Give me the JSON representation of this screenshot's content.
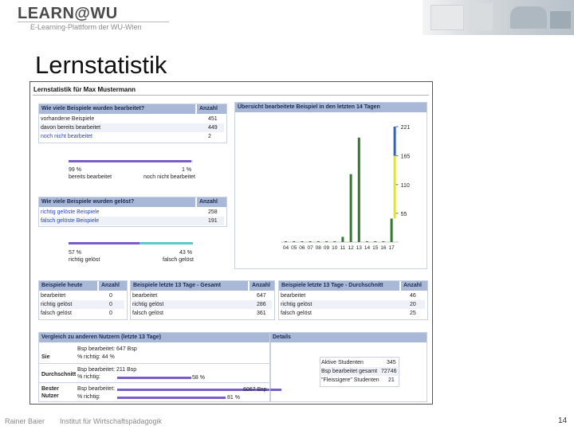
{
  "header": {
    "logo": "LEARN@WU",
    "subtitle": "E-Learning-Plattform der WU-Wien"
  },
  "page_title": "Lernstatistik",
  "stats_title": "Lernstatistik für Max Mustermann",
  "processed": {
    "header": "Wie viele Beispiele wurden bearbeitet?",
    "count_header": "Anzahl",
    "rows": [
      {
        "label": "vorhandene Beispiele",
        "value": "451"
      },
      {
        "label": "davon bereits bearbeitet",
        "value": "449"
      },
      {
        "label": "noch nicht bearbeitet",
        "value": "2"
      }
    ],
    "bar": {
      "done_fraction": 0.99,
      "left_pct": "99 %",
      "left_label": "bereits bearbeitet",
      "right_pct": "1 %",
      "right_label": "noch nicht bearbeitet"
    }
  },
  "solved": {
    "header": "Wie viele Beispiele wurden gelöst?",
    "count_header": "Anzahl",
    "rows": [
      {
        "label": "richtig gelöste Beispiele",
        "value": "258"
      },
      {
        "label": "falsch gelöste Beispiele",
        "value": "191"
      }
    ],
    "bar": {
      "correct_fraction": 0.57,
      "left_pct": "57 %",
      "left_label": "richtig gelöst",
      "right_pct": "43 %",
      "right_label": "falsch gelöst"
    }
  },
  "chart_data": {
    "type": "bar",
    "title": "Übersicht bearbeitete Beispiel in den letzten 14 Tagen",
    "categories": [
      "04",
      "05",
      "06",
      "07",
      "08",
      "09",
      "10",
      "11",
      "12",
      "13",
      "14",
      "15",
      "16",
      "17"
    ],
    "series": [
      {
        "values": [
          1,
          1,
          1,
          1,
          1,
          1,
          1,
          10,
          130,
          200,
          1,
          1,
          1,
          45
        ],
        "color": "#2f7a2f"
      },
      {
        "values": [
          0,
          0,
          0,
          0,
          0,
          0,
          0,
          0,
          0,
          0,
          0,
          0,
          0,
          221
        ],
        "color": "#3b5fb8"
      },
      {
        "values": [
          0,
          0,
          0,
          0,
          0,
          0,
          0,
          0,
          0,
          0,
          0,
          0,
          0,
          165
        ],
        "color": "#e2e23a"
      }
    ],
    "ytick_labels": [
      "221",
      "165",
      "110",
      "55"
    ],
    "ylim": [
      0,
      221
    ],
    "grid": false
  },
  "tables": [
    {
      "header": "Beispiele heute",
      "count_header": "Anzahl",
      "rows": [
        {
          "label": "bearbeitet",
          "value": "0"
        },
        {
          "label": "richtig gelöst",
          "value": "0"
        },
        {
          "label": "falsch gelöst",
          "value": "0"
        }
      ]
    },
    {
      "header": "Beispiele letzte 13 Tage - Gesamt",
      "count_header": "Anzahl",
      "rows": [
        {
          "label": "bearbeitet",
          "value": "647"
        },
        {
          "label": "richtig gelöst",
          "value": "286"
        },
        {
          "label": "falsch gelöst",
          "value": "361"
        }
      ]
    },
    {
      "header": "Beispiele letzte 13 Tage - Durchschnitt",
      "count_header": "Anzahl",
      "rows": [
        {
          "label": "bearbeitet",
          "value": "46"
        },
        {
          "label": "richtig gelöst",
          "value": "20"
        },
        {
          "label": "falsch gelöst",
          "value": "25"
        }
      ]
    }
  ],
  "comparison": {
    "header": "Vergleich zu anderen Nutzern (letzte 13 Tage)",
    "details_header": "Details",
    "rows": [
      {
        "label": "Sie",
        "line1": "Bsp bearbeitet: 647 Bsp",
        "line2": "% richtig: 44 %",
        "bar1_fraction": 0.09,
        "bar2_fraction": 0.44,
        "bar1_text": "",
        "bar2_text": ""
      },
      {
        "label": "Durchschnitt",
        "line1": "Bsp bearbeitet: 211 Bsp",
        "line2": "% richtig:",
        "bar1_fraction": 0.03,
        "bar2_fraction": 0.58,
        "bar1_text": "",
        "bar2_text": "58 %"
      },
      {
        "label": "Bester Nutzer",
        "line1": "Bsp bearbeitet:",
        "line2": "% richtig:",
        "bar1_fraction": 1.0,
        "bar2_fraction": 0.81,
        "bar1_text": "6067 Bsp",
        "bar2_text": "81 %"
      }
    ],
    "details": [
      {
        "label": "Aktive Studenten",
        "value": "345"
      },
      {
        "label": "Bsp bearbeitet gesamt",
        "value": "72746"
      },
      {
        "label": "\"Fleissigere\" Studenten",
        "value": "21"
      }
    ]
  },
  "footer": {
    "author": "Rainer Baier",
    "institute": "Institut für Wirtschaftspädagogik",
    "slide_number": "14"
  },
  "colors": {
    "header_bar": "#a9b8d6",
    "green": "#2f7a2f",
    "blue": "#3b5fb8",
    "yellow": "#e2e23a",
    "purple": "#7a5ec8",
    "teal": "#5ec8c8"
  }
}
